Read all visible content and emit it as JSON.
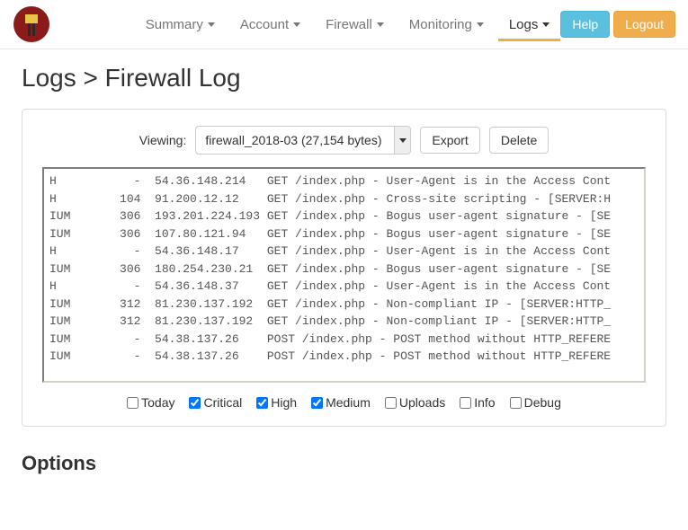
{
  "nav": {
    "items": [
      {
        "label": "Summary",
        "active": false
      },
      {
        "label": "Account",
        "active": false
      },
      {
        "label": "Firewall",
        "active": false
      },
      {
        "label": "Monitoring",
        "active": false
      },
      {
        "label": "Logs",
        "active": true
      }
    ],
    "help": "Help",
    "logout": "Logout"
  },
  "page": {
    "title": "Logs > Firewall Log",
    "viewing_label": "Viewing:",
    "selected_file": "firewall_2018-03 (27,154 bytes)",
    "export": "Export",
    "delete": "Delete"
  },
  "log_lines": [
    "H           -  54.36.148.214   GET /index.php - User-Agent is in the Access Cont",
    "H         104  91.200.12.12    GET /index.php - Cross-site scripting - [SERVER:H",
    "IUM       306  193.201.224.193 GET /index.php - Bogus user-agent signature - [SE",
    "IUM       306  107.80.121.94   GET /index.php - Bogus user-agent signature - [SE",
    "H           -  54.36.148.17    GET /index.php - User-Agent is in the Access Cont",
    "IUM       306  180.254.230.21  GET /index.php - Bogus user-agent signature - [SE",
    "H           -  54.36.148.37    GET /index.php - User-Agent is in the Access Cont",
    "IUM       312  81.230.137.192  GET /index.php - Non-compliant IP - [SERVER:HTTP_",
    "IUM       312  81.230.137.192  GET /index.php - Non-compliant IP - [SERVER:HTTP_",
    "IUM         -  54.38.137.26    POST /index.php - POST method without HTTP_REFERE",
    "IUM         -  54.38.137.26    POST /index.php - POST method without HTTP_REFERE"
  ],
  "filters": [
    {
      "label": "Today",
      "checked": false
    },
    {
      "label": "Critical",
      "checked": true
    },
    {
      "label": "High",
      "checked": true
    },
    {
      "label": "Medium",
      "checked": true
    },
    {
      "label": "Uploads",
      "checked": false
    },
    {
      "label": "Info",
      "checked": false
    },
    {
      "label": "Debug",
      "checked": false
    }
  ],
  "options_title": "Options"
}
